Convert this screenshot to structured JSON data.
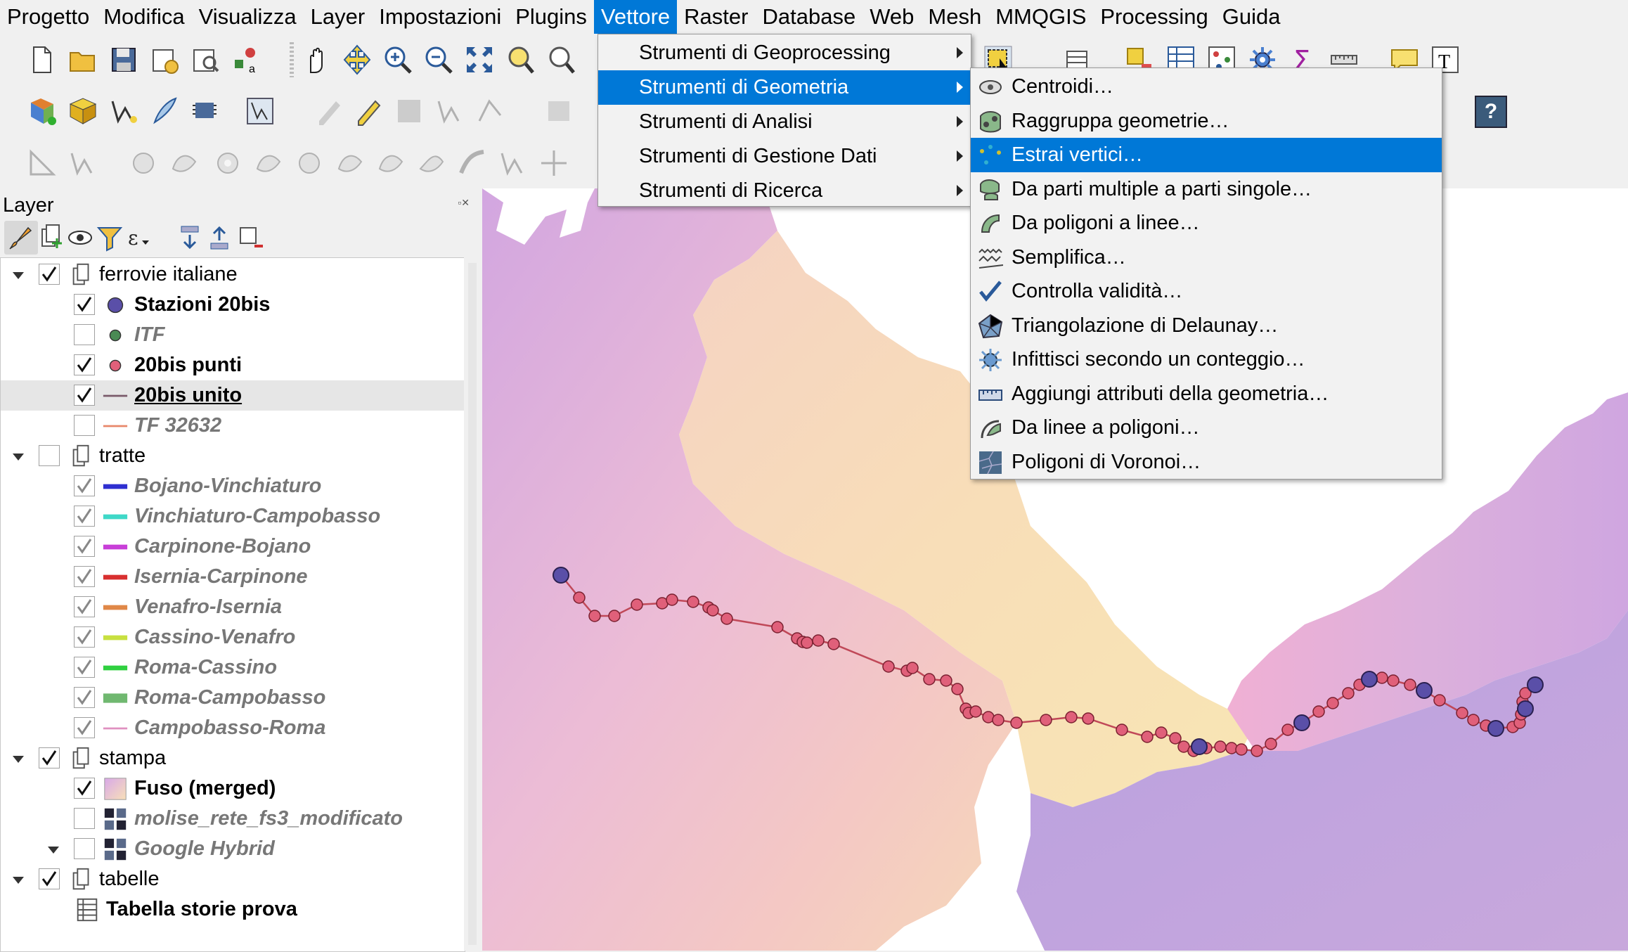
{
  "menubar": {
    "items": [
      "Progetto",
      "Modifica",
      "Visualizza",
      "Layer",
      "Impostazioni",
      "Plugins",
      "Vettore",
      "Raster",
      "Database",
      "Web",
      "Mesh",
      "MMQGIS",
      "Processing",
      "Guida"
    ],
    "active": "Vettore"
  },
  "vector_menu": {
    "items": [
      {
        "label": "Strumenti di Geoprocessing"
      },
      {
        "label": "Strumenti di Geometria"
      },
      {
        "label": "Strumenti di Analisi"
      },
      {
        "label": "Strumenti di Gestione Dati"
      },
      {
        "label": "Strumenti di Ricerca"
      }
    ],
    "highlighted": "Strumenti di Geometria"
  },
  "geometry_submenu": {
    "items": [
      {
        "label": "Centroidi…",
        "icon": "centroid-icon"
      },
      {
        "label": "Raggruppa geometrie…",
        "icon": "collect-geometries-icon"
      },
      {
        "label": "Estrai vertici…",
        "icon": "extract-vertices-icon"
      },
      {
        "label": "Da parti multiple a parti singole…",
        "icon": "multipart-icon"
      },
      {
        "label": "Da poligoni a linee…",
        "icon": "polygon-to-line-icon"
      },
      {
        "label": "Semplifica…",
        "icon": "simplify-icon"
      },
      {
        "label": "Controlla validità…",
        "icon": "check-validity-icon"
      },
      {
        "label": "Triangolazione di Delaunay…",
        "icon": "delaunay-icon"
      },
      {
        "label": "Infittisci secondo un conteggio…",
        "icon": "densify-icon"
      },
      {
        "label": "Aggiungi attributi della geometria…",
        "icon": "geometry-attributes-icon"
      },
      {
        "label": "Da linee a poligoni…",
        "icon": "line-to-polygon-icon"
      },
      {
        "label": "Poligoni di Voronoi…",
        "icon": "voronoi-icon"
      }
    ],
    "highlighted": "Estrai vertici…"
  },
  "layers_panel": {
    "title": "Layer",
    "help_button": "?",
    "tree": [
      {
        "label": "ferrovie italiane",
        "type": "group",
        "checked": true,
        "expanded": true,
        "style": "normal"
      },
      {
        "label": "Stazioni 20bis",
        "type": "point",
        "color": "#5a4fa8",
        "checked": true,
        "style": "bold"
      },
      {
        "label": "ITF",
        "type": "point",
        "color": "#4a8a54",
        "checked": false,
        "style": "italic"
      },
      {
        "label": "20bis punti",
        "type": "point",
        "color": "#e0607a",
        "checked": true,
        "style": "bold"
      },
      {
        "label": "20bis unito",
        "type": "line",
        "color": "#7a5a6a",
        "checked": true,
        "style": "bold-underline",
        "selected": true
      },
      {
        "label": "TF 32632",
        "type": "line",
        "color": "#e8876a",
        "checked": false,
        "style": "italic"
      },
      {
        "label": "tratte",
        "type": "group",
        "checked": false,
        "expanded": true,
        "style": "normal"
      },
      {
        "label": "Bojano-Vinchiaturo",
        "type": "thickline",
        "color": "#2f2fd0",
        "checked": true,
        "style": "italic"
      },
      {
        "label": "Vinchiaturo-Campobasso",
        "type": "thickline",
        "color": "#3fd8c8",
        "checked": true,
        "style": "italic"
      },
      {
        "label": "Carpinone-Bojano",
        "type": "thickline",
        "color": "#c83fd8",
        "checked": true,
        "style": "italic"
      },
      {
        "label": "Isernia-Carpinone",
        "type": "thickline",
        "color": "#d83030",
        "checked": true,
        "style": "italic"
      },
      {
        "label": "Venafro-Isernia",
        "type": "thickline",
        "color": "#e08848",
        "checked": true,
        "style": "italic"
      },
      {
        "label": "Cassino-Venafro",
        "type": "thickline",
        "color": "#c8e040",
        "checked": true,
        "style": "italic"
      },
      {
        "label": "Roma-Cassino",
        "type": "thickline",
        "color": "#30d040",
        "checked": true,
        "style": "italic"
      },
      {
        "label": "Roma-Campobasso",
        "type": "thickline",
        "color": "#70b870",
        "checked": true,
        "style": "italic"
      },
      {
        "label": "Campobasso-Roma",
        "type": "line",
        "color": "#e090c0",
        "checked": true,
        "style": "italic"
      },
      {
        "label": "stampa",
        "type": "group",
        "checked": true,
        "expanded": true,
        "style": "normal"
      },
      {
        "label": "Fuso (merged)",
        "type": "raster-gradient",
        "checked": true,
        "style": "bold"
      },
      {
        "label": "molise_rete_fs3_modificato",
        "type": "raster",
        "checked": false,
        "style": "italic"
      },
      {
        "label": "Google Hybrid",
        "type": "raster",
        "checked": false,
        "style": "italic",
        "expanded": true
      },
      {
        "label": "tabelle",
        "type": "group",
        "checked": true,
        "expanded": true,
        "style": "normal"
      },
      {
        "label": "Tabella storie prova",
        "type": "table",
        "style": "bold"
      }
    ]
  },
  "colors": {
    "accent": "#0078d7",
    "station": "#5a4fa8",
    "point": "#e0607a",
    "line": "#c04858"
  }
}
